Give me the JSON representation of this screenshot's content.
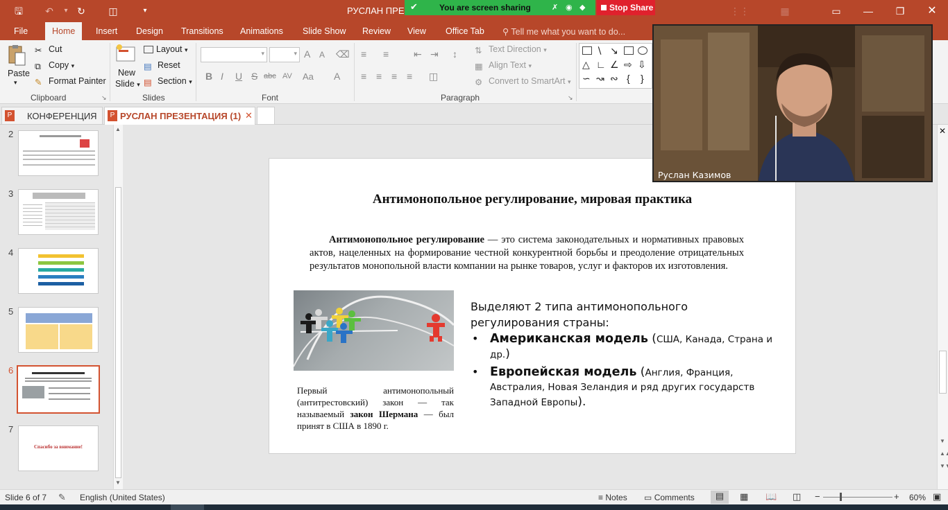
{
  "titlebar": {
    "doc_title": "РУСЛАН ПРЕЗЕ",
    "share_text": "You are screen sharing",
    "stop_share": "Stop Share"
  },
  "ribbon_tabs": [
    "File",
    "Home",
    "Insert",
    "Design",
    "Transitions",
    "Animations",
    "Slide Show",
    "Review",
    "View",
    "Office Tab"
  ],
  "tell_me": "Tell me what you want to do...",
  "clipboard": {
    "paste": "Paste",
    "cut": "Cut",
    "copy": "Copy",
    "format_painter": "Format Painter",
    "label": "Clipboard"
  },
  "slides_group": {
    "new_slide_1": "New",
    "new_slide_2": "Slide",
    "layout": "Layout",
    "reset": "Reset",
    "section": "Section",
    "label": "Slides"
  },
  "font_group": {
    "label": "Font",
    "bold": "B",
    "italic": "I",
    "underline": "U",
    "strike": "S",
    "abc": "abc",
    "av": "AV",
    "aa": "Aa",
    "grow": "A",
    "shrink": "A",
    "color": "A"
  },
  "paragraph_group": {
    "label": "Paragraph",
    "text_direction": "Text Direction",
    "align_text": "Align Text",
    "convert_smartart": "Convert to SmartArt"
  },
  "doc_tabs": {
    "tab1": "КОНФЕРЕНЦИЯ",
    "tab2": "РУСЛАН ПРЕЗЕНТАЦИЯ (1)"
  },
  "thumbs": [
    {
      "num": "2"
    },
    {
      "num": "3"
    },
    {
      "num": "4"
    },
    {
      "num": "5"
    },
    {
      "num": "6"
    },
    {
      "num": "7",
      "text": "Спасибо за внимание!"
    }
  ],
  "slide": {
    "title": "Антимонопольное регулирование, мировая практика",
    "para_bold": "Антимонопольное регулирование",
    "para_rest": " — это система законодательных и нормативных правовых актов, нацеленных на формирование честной конкурентной борьбы и преодоление отрицательных результатов монопольной власти компании на рынке товаров, услуг и факторов их изготовления.",
    "caption_pre": "Первый антимонопольный (антитрестовский) закон — так называемый ",
    "caption_bold": "закон Шермана",
    "caption_post": " — был принят в США в 1890 г.",
    "intro": "Выделяют 2 типа антимонопольного регулирования страны:",
    "bullet_glyph": "•",
    "item1_bold": "Американская модель",
    "item1_open": " (",
    "item1_small": "США, Канада, Страна и др.",
    "item1_close": ")",
    "item2_bold": "Европейская модель",
    "item2_open": " (",
    "item2_small": "Англия, Франция, Австралия, Новая Зеландия и ряд других государств Западной Европы",
    "item2_close": ")."
  },
  "video": {
    "name": "Руслан Казимов"
  },
  "status": {
    "slide_of": "Slide 6 of 7",
    "language": "English (United States)",
    "notes": "Notes",
    "comments": "Comments",
    "zoom": "60%"
  },
  "colors": {
    "accent": "#b7472a",
    "share_green": "#2fb44a",
    "stop_red": "#e0212d"
  }
}
